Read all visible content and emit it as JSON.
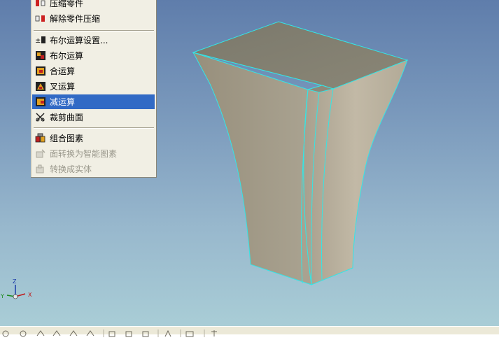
{
  "menu": {
    "items": [
      {
        "label": "压缩零件",
        "icon": "compress-part-icon",
        "state": "normal"
      },
      {
        "label": "解除零件压缩",
        "icon": "uncompress-part-icon",
        "state": "normal"
      },
      {
        "label": "布尔运算设置...",
        "icon": "boolean-settings-icon",
        "state": "normal"
      },
      {
        "label": "布尔运算",
        "icon": "boolean-operation-icon",
        "state": "normal"
      },
      {
        "label": "合运算",
        "icon": "union-icon",
        "state": "normal"
      },
      {
        "label": "叉运算",
        "icon": "intersect-icon",
        "state": "normal"
      },
      {
        "label": "减运算",
        "icon": "subtract-icon",
        "state": "selected"
      },
      {
        "label": "裁剪曲面",
        "icon": "trim-surface-icon",
        "state": "normal"
      },
      {
        "label": "组合图素",
        "icon": "combine-shapes-icon",
        "state": "normal"
      },
      {
        "label": "面转换为智能图素",
        "icon": "face-to-smart-shape-icon",
        "state": "disabled"
      },
      {
        "label": "转换成实体",
        "icon": "convert-to-solid-icon",
        "state": "disabled"
      }
    ]
  },
  "axes": {
    "x": "X",
    "y": "Y",
    "z": "Z"
  },
  "colors": {
    "selection": "#316ac5",
    "menu_bg": "#f1efe4",
    "edge_highlight": "#33e6e6",
    "solid_face": "#a59e8c"
  }
}
